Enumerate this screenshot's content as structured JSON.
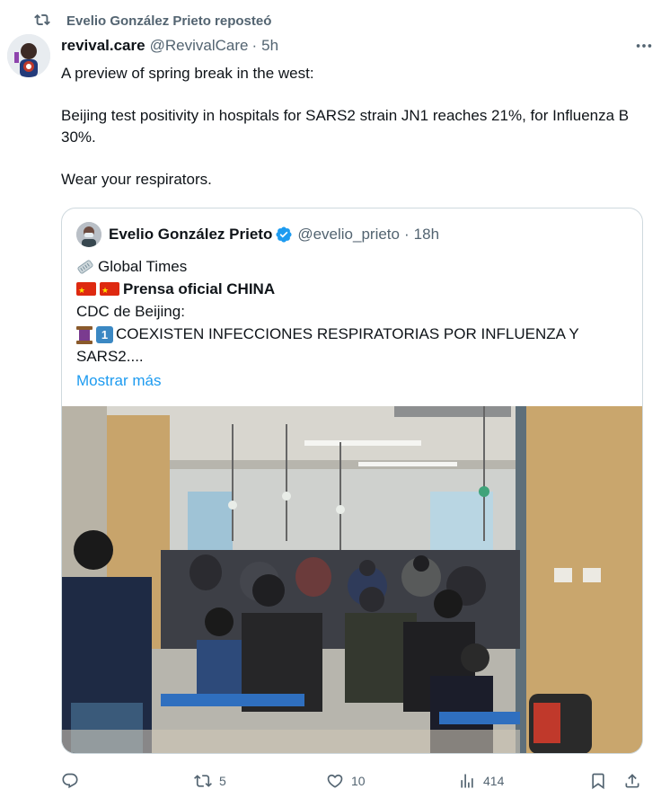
{
  "repost": {
    "label": "Evelio González Prieto reposteó",
    "icon": "repost-icon"
  },
  "tweet": {
    "author_name": "revival.care",
    "author_handle": "@RevivalCare",
    "separator": "·",
    "time": "5h",
    "more_icon": "more-icon",
    "text_lines": [
      "A preview of spring break in the west:",
      "Beijing test positivity in hospitals for SARS2 strain JN1 reaches 21%, for Influenza B 30%.",
      "Wear your respirators."
    ]
  },
  "quote": {
    "author_name": "Evelio González Prieto",
    "verified_icon": "verified-badge-icon",
    "author_handle": "@evelio_prieto",
    "separator": "·",
    "time": "18h",
    "line1": "Global Times",
    "line2": "Prensa oficial CHINA",
    "line3": "CDC de Beijing:",
    "line4": "COEXISTEN INFECCIONES RESPIRATORIAS POR INFLUENZA Y SARS2....",
    "keycap_number": "1",
    "show_more": "Mostrar más",
    "image_icon": "hospital-waiting-room-photo"
  },
  "actions": {
    "reply_icon": "reply-icon",
    "reply_count": "",
    "repost_icon": "repost-icon",
    "repost_count": "5",
    "like_icon": "heart-icon",
    "like_count": "10",
    "views_icon": "views-icon",
    "views_count": "414",
    "bookmark_icon": "bookmark-icon",
    "share_icon": "share-icon"
  },
  "colors": {
    "text": "#0f1419",
    "secondary": "#536471",
    "link": "#1d9bf0",
    "border": "#cfd9de",
    "verified": "#1d9bf0"
  }
}
